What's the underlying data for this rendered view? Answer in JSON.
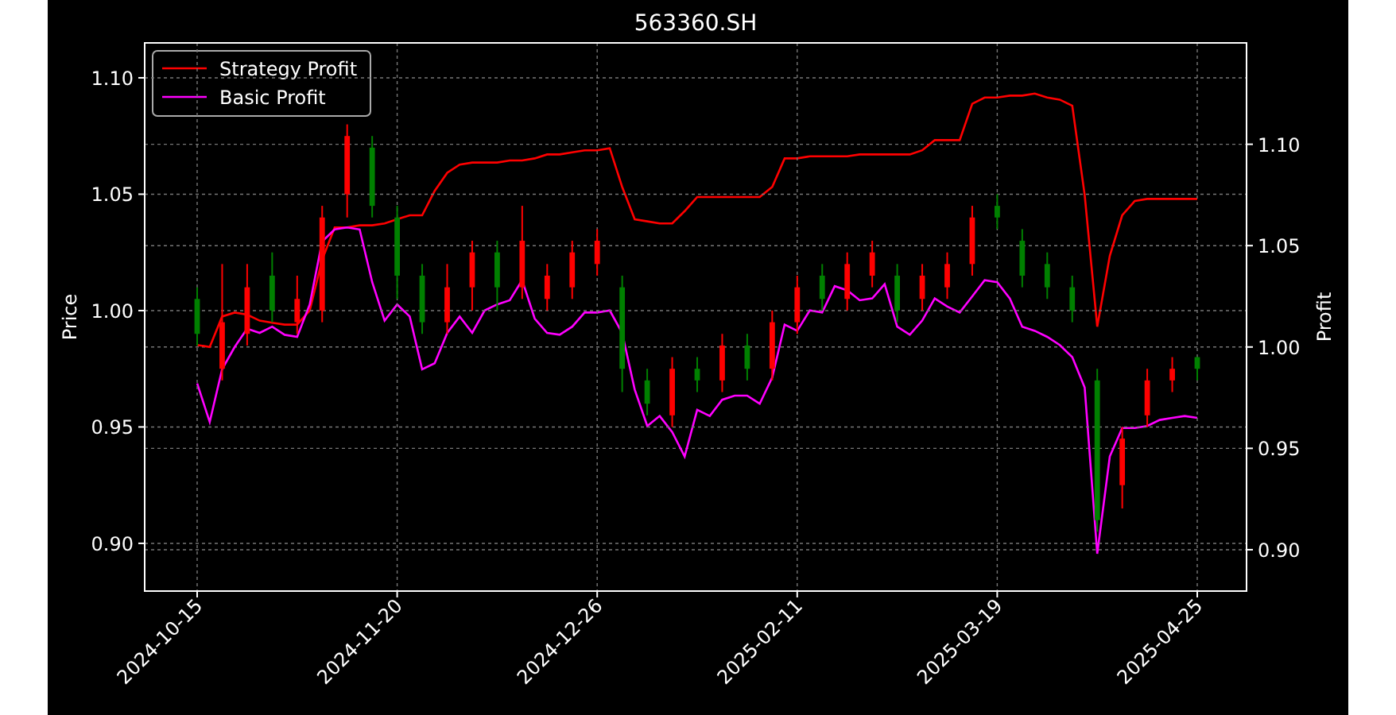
{
  "figure": {
    "title": "563360.SH",
    "price_chart": {
      "chart_data": {
        "type": "candlestick",
        "ylabel": "Price",
        "categories": [
          "2024-10-15",
          null,
          null,
          null,
          null,
          null,
          null,
          null,
          "2024-11-20",
          null,
          null,
          null,
          null,
          null,
          null,
          null,
          "2024-12-26",
          null,
          null,
          null,
          null,
          null,
          null,
          null,
          "2025-02-11",
          null,
          null,
          null,
          null,
          null,
          null,
          null,
          "2025-03-19",
          null,
          null,
          null,
          null,
          null,
          null,
          null,
          "2025-04-25"
        ],
        "grid": true,
        "ylim": [
          0.8795,
          1.115
        ],
        "yticks": [
          {
            "value": 0.9,
            "label": "0.90"
          },
          {
            "value": 0.95,
            "label": "0.95"
          },
          {
            "value": 1.0,
            "label": "1.00"
          },
          {
            "value": 1.05,
            "label": "1.05"
          },
          {
            "value": 1.1,
            "label": "1.10"
          }
        ],
        "ohlc": [
          [
            1.005,
            1.01,
            0.985,
            0.99
          ],
          [
            0.975,
            1.02,
            0.97,
            0.995
          ],
          [
            0.99,
            1.02,
            0.985,
            1.01
          ],
          [
            1.015,
            1.025,
            0.995,
            1.0
          ],
          [
            0.995,
            1.015,
            0.99,
            1.005
          ],
          [
            1.0,
            1.045,
            0.995,
            1.04
          ],
          [
            1.05,
            1.08,
            1.04,
            1.075
          ],
          [
            1.07,
            1.075,
            1.04,
            1.045
          ],
          [
            1.04,
            1.045,
            1.005,
            1.015
          ],
          [
            1.015,
            1.02,
            0.99,
            0.995
          ],
          [
            0.995,
            1.02,
            0.99,
            1.01
          ],
          [
            1.01,
            1.03,
            1.0,
            1.025
          ],
          [
            1.025,
            1.03,
            1.0,
            1.01
          ],
          [
            1.01,
            1.045,
            1.005,
            1.03
          ],
          [
            1.005,
            1.02,
            1.0,
            1.015
          ],
          [
            1.01,
            1.03,
            1.005,
            1.025
          ],
          [
            1.02,
            1.035,
            1.015,
            1.03
          ],
          [
            1.01,
            1.015,
            0.965,
            0.975
          ],
          [
            0.97,
            0.975,
            0.955,
            0.96
          ],
          [
            0.955,
            0.98,
            0.95,
            0.975
          ],
          [
            0.975,
            0.98,
            0.965,
            0.97
          ],
          [
            0.97,
            0.99,
            0.965,
            0.985
          ],
          [
            0.985,
            0.99,
            0.97,
            0.975
          ],
          [
            0.975,
            1.0,
            0.97,
            0.995
          ],
          [
            0.995,
            1.015,
            0.99,
            1.01
          ],
          [
            1.015,
            1.02,
            1.0,
            1.005
          ],
          [
            1.005,
            1.025,
            1.0,
            1.02
          ],
          [
            1.015,
            1.03,
            1.01,
            1.025
          ],
          [
            1.015,
            1.02,
            0.995,
            1.0
          ],
          [
            1.005,
            1.02,
            1.0,
            1.015
          ],
          [
            1.01,
            1.025,
            1.005,
            1.02
          ],
          [
            1.02,
            1.045,
            1.015,
            1.04
          ],
          [
            1.045,
            1.05,
            1.035,
            1.04
          ],
          [
            1.03,
            1.035,
            1.01,
            1.015
          ],
          [
            1.02,
            1.025,
            1.005,
            1.01
          ],
          [
            1.01,
            1.015,
            0.995,
            1.0
          ],
          [
            0.97,
            0.975,
            0.905,
            0.91
          ],
          [
            0.925,
            0.95,
            0.915,
            0.945
          ],
          [
            0.955,
            0.975,
            0.95,
            0.97
          ],
          [
            0.97,
            0.98,
            0.965,
            0.975
          ],
          [
            0.98,
            0.98,
            0.97,
            0.975
          ]
        ]
      }
    },
    "profit_chart": {
      "chart_data": {
        "type": "line",
        "ylabel": "Profit",
        "grid": true,
        "legend": "upper left",
        "categories": [
          null,
          null,
          null,
          null,
          null,
          null,
          null,
          null,
          null,
          null,
          null,
          null,
          null,
          null,
          null,
          null,
          null,
          null,
          null,
          null,
          null,
          null,
          null,
          null,
          null,
          null,
          null,
          null,
          null,
          null,
          null,
          null,
          null,
          null,
          null,
          null,
          null,
          null,
          null,
          null,
          null,
          null,
          null,
          null,
          null,
          null,
          null,
          null,
          null,
          null,
          null,
          null,
          null,
          null,
          null,
          null,
          null,
          null,
          null,
          null,
          null,
          null,
          null,
          null,
          null,
          null,
          null,
          null,
          null,
          null,
          null,
          null,
          null,
          null,
          null,
          null,
          null,
          null,
          null,
          null,
          null
        ],
        "ylim": [
          0.8796,
          1.15
        ],
        "yticks": [
          {
            "value": 0.9,
            "label": "0.90"
          },
          {
            "value": 0.95,
            "label": "0.95"
          },
          {
            "value": 1.0,
            "label": "1.00"
          },
          {
            "value": 1.05,
            "label": "1.05"
          },
          {
            "value": 1.1,
            "label": "1.10"
          }
        ],
        "series": [
          {
            "name": "Strategy Profit",
            "color": "#ff0000",
            "values": [
              1.001,
              1.0,
              1.015,
              1.017,
              1.016,
              1.013,
              1.012,
              1.011,
              1.011,
              1.018,
              1.043,
              1.059,
              1.059,
              1.06,
              1.06,
              1.061,
              1.063,
              1.065,
              1.065,
              1.077,
              1.086,
              1.09,
              1.091,
              1.091,
              1.091,
              1.092,
              1.092,
              1.093,
              1.095,
              1.095,
              1.096,
              1.097,
              1.097,
              1.098,
              1.079,
              1.063,
              1.062,
              1.061,
              1.061,
              1.067,
              1.074,
              1.074,
              1.074,
              1.074,
              1.074,
              1.074,
              1.079,
              1.093,
              1.093,
              1.094,
              1.094,
              1.094,
              1.094,
              1.095,
              1.095,
              1.095,
              1.095,
              1.095,
              1.097,
              1.102,
              1.102,
              1.102,
              1.12,
              1.123,
              1.123,
              1.124,
              1.124,
              1.125,
              1.123,
              1.122,
              1.119,
              1.075,
              1.01,
              1.045,
              1.065,
              1.072,
              1.073,
              1.073,
              1.073,
              1.073,
              1.073
            ]
          },
          {
            "name": "Basic Profit",
            "color": "#ff00ff",
            "values": [
              0.982,
              0.963,
              0.989,
              1.0,
              1.009,
              1.007,
              1.01,
              1.006,
              1.005,
              1.021,
              1.052,
              1.058,
              1.059,
              1.058,
              1.032,
              1.013,
              1.021,
              1.015,
              0.989,
              0.992,
              1.007,
              1.015,
              1.007,
              1.018,
              1.021,
              1.023,
              1.033,
              1.014,
              1.007,
              1.006,
              1.01,
              1.017,
              1.017,
              1.018,
              1.007,
              0.979,
              0.961,
              0.966,
              0.958,
              0.946,
              0.969,
              0.966,
              0.974,
              0.976,
              0.976,
              0.972,
              0.985,
              1.011,
              1.008,
              1.018,
              1.017,
              1.03,
              1.028,
              1.023,
              1.024,
              1.031,
              1.01,
              1.006,
              1.013,
              1.024,
              1.02,
              1.017,
              1.025,
              1.033,
              1.032,
              1.024,
              1.01,
              1.008,
              1.005,
              1.001,
              0.995,
              0.98,
              0.898,
              0.946,
              0.96,
              0.96,
              0.961,
              0.964,
              0.965,
              0.966,
              0.965
            ]
          }
        ]
      }
    }
  }
}
